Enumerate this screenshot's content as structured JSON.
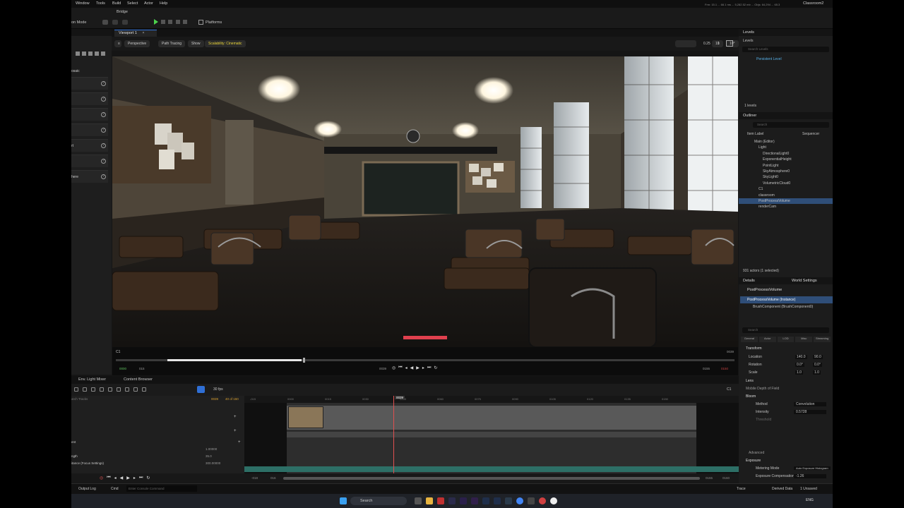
{
  "menu": [
    "Window",
    "Tools",
    "Build",
    "Select",
    "Actor",
    "Help"
  ],
  "bridge_label": "Bridge",
  "project_name": "Classroom2",
  "stats_text": "Frm: 15.1 ... 66.1 ms ... 5,282.52 mb ... Objs: 64,294 ... 65.3",
  "mode_label": "on Mode",
  "platforms_label": "Platforms",
  "viewport": {
    "tab": "Viewport 1",
    "perspective": "Perspective",
    "path_tracing": "Path Tracing",
    "show": "Show",
    "scalability": "Scalability: Cinematic",
    "grid_value": "10",
    "angle_value": "10°",
    "scale_value": "0.25",
    "cam_speed": "1",
    "camera_label": "C1",
    "frame_left": "0000",
    "frame_left2": "015",
    "frame_center": "0039",
    "frame_right": "0155",
    "frame_right2": "0150",
    "frame_right_top": "0039"
  },
  "left_panel": {
    "rows": [
      "",
      "",
      "",
      "",
      "rt",
      "",
      "here"
    ],
    "top_label": "osaic"
  },
  "levels": {
    "title": "Levels",
    "dropdown": "Levels",
    "search": "Search Levels",
    "persistent": "Persistent Level",
    "count": "1 levels"
  },
  "outliner": {
    "title": "Outliner",
    "search": "Search",
    "col_label": "Item Label",
    "col_seq": "Sequencer",
    "items": [
      {
        "label": "Main (Editor)",
        "indent": 0
      },
      {
        "label": "Light",
        "indent": 1
      },
      {
        "label": "DirectionalLight0",
        "indent": 2
      },
      {
        "label": "ExponentialHeight",
        "indent": 2
      },
      {
        "label": "PointLight",
        "indent": 2
      },
      {
        "label": "SkyAtmosphere0",
        "indent": 2
      },
      {
        "label": "SkyLight0",
        "indent": 2
      },
      {
        "label": "VolumetricCloud0",
        "indent": 2
      },
      {
        "label": "C1",
        "indent": 1
      },
      {
        "label": "classroom",
        "indent": 1
      },
      {
        "label": "PostProcessVolume",
        "indent": 1
      },
      {
        "label": "renderCam",
        "indent": 1
      }
    ],
    "actor_count": "931 actors (1 selected)"
  },
  "details": {
    "title": "Details",
    "world_settings": "World Settings",
    "object": "PostProcessVolume",
    "instance": "PostProcessVolume (Instance)",
    "component": "BrushComponent (BrushComponent0)",
    "search": "Search",
    "tabs": [
      "General",
      "Actor",
      "LOD",
      "Misc",
      "Streaming"
    ],
    "transform": "Transform",
    "location": "Location",
    "rotation": "Rotation",
    "scale": "Scale",
    "loc_x": "140.0",
    "loc_y": "90.0",
    "rot_x": "0.0°",
    "rot_y": "0.0°",
    "scale_x": "1.0",
    "scale_y": "1.0",
    "lens": "Lens",
    "mobile_dof": "Mobile Depth of Field",
    "bloom": "Bloom",
    "method": "Method",
    "method_value": "Convolution",
    "intensity": "Intensity",
    "intensity_value": "0.5728",
    "threshold": "Threshold",
    "advanced": "Advanced",
    "exposure": "Exposure",
    "metering_mode": "Metering Mode",
    "metering_value": "Auto Exposure Histogram",
    "exposure_comp": "Exposure Compensation",
    "exposure_comp_value": "-1.26"
  },
  "sequencer": {
    "tab1": "Env. Light Mixer",
    "tab2": "Content Browser",
    "fps": "30 fps",
    "camera_label": "C1",
    "search": "arch Tracks",
    "frame_current": "0039",
    "frame_range": "40 of 150",
    "playhead": "0039",
    "ruler": [
      "-015",
      "0000",
      "0015",
      "0030",
      "0045",
      "0060",
      "0075",
      "0090",
      "0105",
      "0120",
      "0135",
      "0150"
    ],
    "track_labels": [
      "ent",
      "ngth",
      "itance (Focus Settings)"
    ],
    "track_values": [
      "1.00000",
      "35.0",
      "300.00000"
    ],
    "bottom_left": "-018",
    "bottom_left2": "016",
    "bottom_right": "0155",
    "bottom_right2": "0160"
  },
  "status": {
    "output_log": "Output Log",
    "cmd": "Cmd",
    "console_placeholder": "Enter Console Command",
    "trace": "Trace",
    "derived_data": "Derived Data",
    "unsaved": "1 Unsaved"
  },
  "taskbar": {
    "search": "Search",
    "lang": "ENG"
  }
}
